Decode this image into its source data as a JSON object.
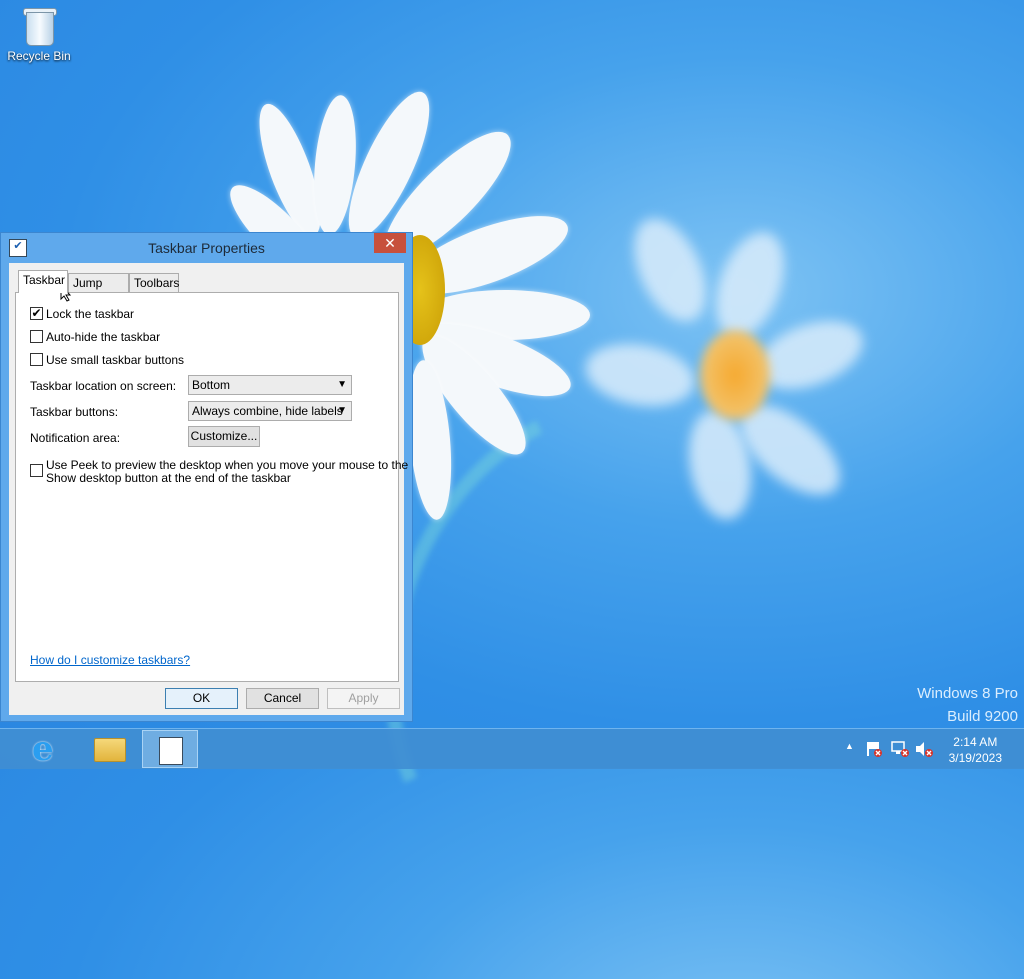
{
  "desktop": {
    "icons": [
      {
        "label": "Recycle Bin",
        "icon": "recycle-bin-icon"
      }
    ],
    "watermark": {
      "line1": "Windows 8 Pro",
      "line2": "Build 9200"
    }
  },
  "dialog": {
    "title": "Taskbar Properties",
    "close_glyph": "✕",
    "tabs": [
      {
        "label": "Taskbar",
        "active": true
      },
      {
        "label": "Jump Lists",
        "active": false
      },
      {
        "label": "Toolbars",
        "active": false
      }
    ],
    "checkboxes": {
      "lock": {
        "label": "Lock the taskbar",
        "checked": true,
        "mark": "✔"
      },
      "autohide": {
        "label": "Auto-hide the taskbar",
        "checked": false
      },
      "small": {
        "label": "Use small taskbar buttons",
        "checked": false
      },
      "peek": {
        "label_line1": "Use Peek to preview the desktop when you move your mouse to the",
        "label_line2": "Show desktop button at the end of the taskbar",
        "checked": false
      }
    },
    "location": {
      "label": "Taskbar location on screen:",
      "value": "Bottom"
    },
    "buttons_setting": {
      "label": "Taskbar buttons:",
      "value": "Always combine, hide labels"
    },
    "notification": {
      "label": "Notification area:",
      "button": "Customize..."
    },
    "help_link": "How do I customize taskbars?",
    "ok": "OK",
    "cancel": "Cancel",
    "apply": "Apply"
  },
  "taskbar": {
    "apps": [
      {
        "name": "Internet Explorer",
        "icon": "internet-explorer-icon",
        "glyph": "e"
      },
      {
        "name": "File Explorer",
        "icon": "file-explorer-icon"
      },
      {
        "name": "Taskbar Properties",
        "icon": "taskbar-properties-icon",
        "active": true
      }
    ],
    "tray": {
      "chevron": "▲",
      "clock_time": "2:14 AM",
      "clock_date": "3/19/2023"
    }
  },
  "colors": {
    "accent": "#5fa9ec",
    "close": "#c7503c",
    "link": "#0066cc"
  }
}
